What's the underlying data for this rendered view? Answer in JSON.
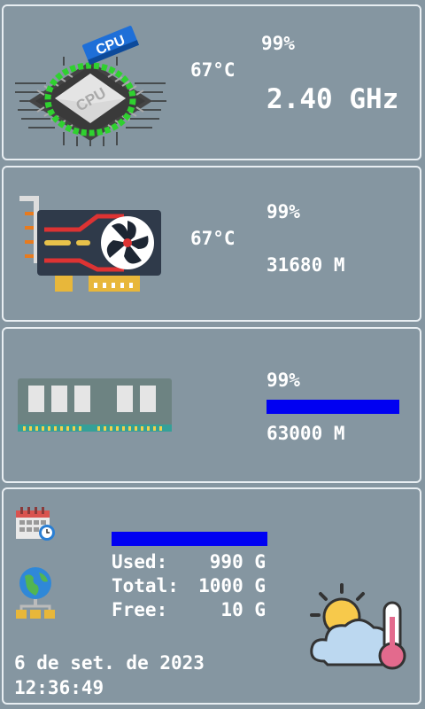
{
  "cpu": {
    "badge": "CPU",
    "chip_label": "CPU",
    "usage": "99%",
    "temperature": "67°C",
    "frequency": "2.40 GHz"
  },
  "gpu": {
    "usage": "99%",
    "temperature": "67°C",
    "memory": "31680 M"
  },
  "ram": {
    "usage": "99%",
    "usage_fraction": 0.99,
    "amount": "63000 M"
  },
  "disk": {
    "usage_fraction": 0.99,
    "used_label": "Used:",
    "used_value": "990 G",
    "total_label": "Total:",
    "total_value": "1000 G",
    "free_label": "Free:",
    "free_value": "10 G"
  },
  "datetime": {
    "date": "6 de set. de 2023",
    "time": "12:36:49"
  },
  "colors": {
    "background": "#8596a1",
    "bar": "#0000f2",
    "text": "#ffffff",
    "panel_border": "#e8eef2"
  },
  "icons": {
    "cpu": "cpu-chip-icon",
    "gpu": "graphics-card-icon",
    "ram": "ram-stick-icon",
    "calendar": "calendar-clock-icon",
    "network": "network-globe-icon",
    "weather": "weather-thermometer-icon"
  }
}
